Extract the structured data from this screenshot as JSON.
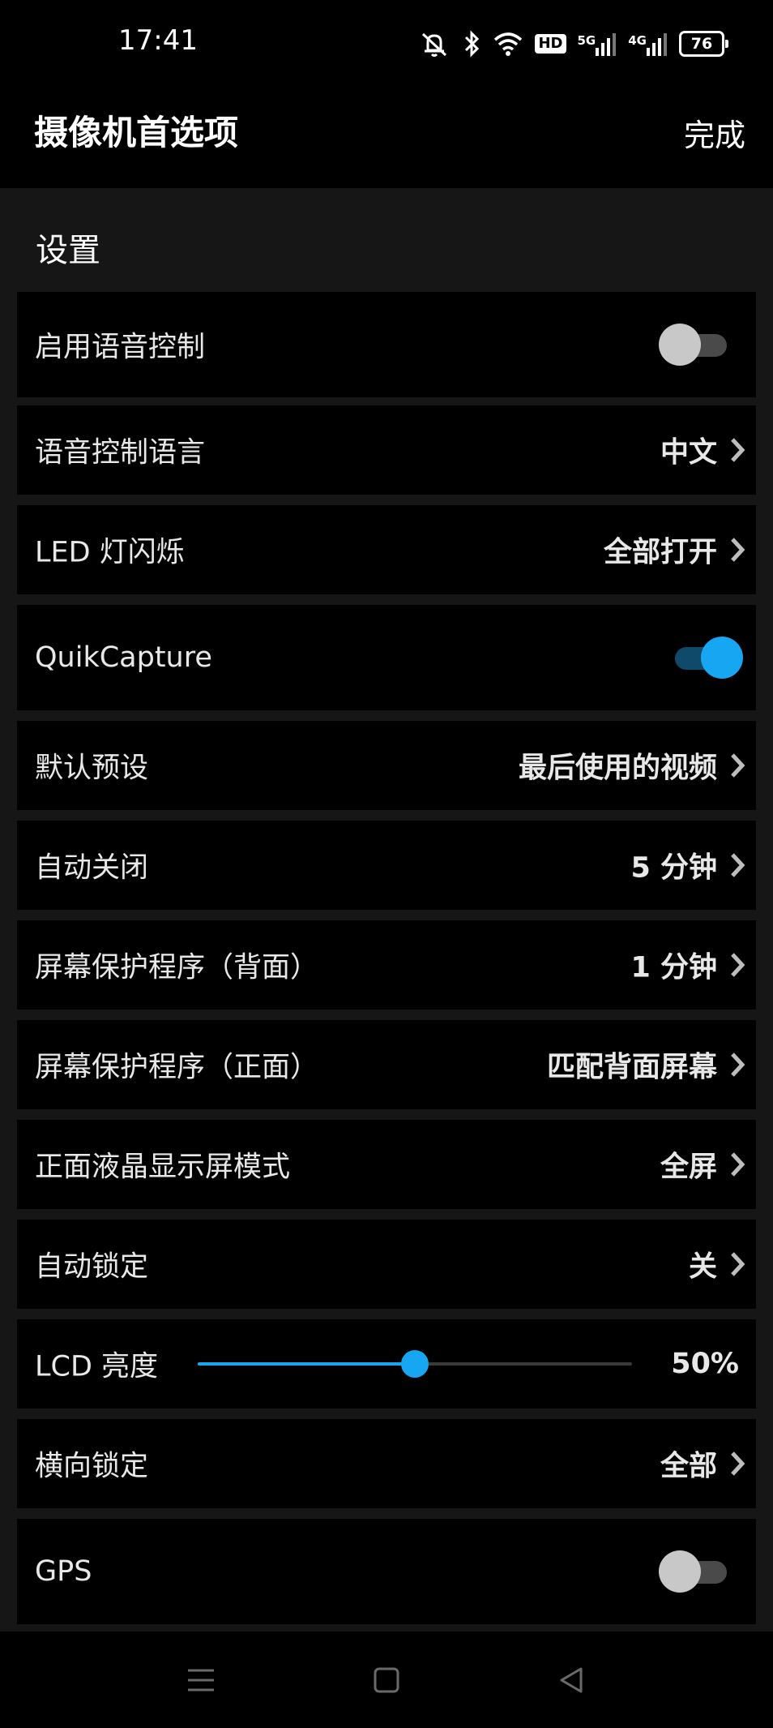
{
  "status_bar": {
    "time": "17:41",
    "hd_badge": "HD",
    "net_5g": "5G",
    "net_4g": "4G",
    "battery": "76"
  },
  "header": {
    "title": "摄像机首选项",
    "done_label": "完成"
  },
  "section": {
    "title": "设置"
  },
  "rows": [
    {
      "label": "启用语音控制",
      "type": "toggle",
      "state": "off"
    },
    {
      "label": "语音控制语言",
      "type": "nav",
      "value": "中文"
    },
    {
      "label": "LED 灯闪烁",
      "type": "nav",
      "value": "全部打开"
    },
    {
      "label": "QuikCapture",
      "type": "toggle",
      "state": "on"
    },
    {
      "label": "默认预设",
      "type": "nav",
      "value": "最后使用的视频"
    },
    {
      "label": "自动关闭",
      "type": "nav",
      "value": "5 分钟"
    },
    {
      "label": "屏幕保护程序（背面）",
      "type": "nav",
      "value": "1 分钟"
    },
    {
      "label": "屏幕保护程序（正面）",
      "type": "nav",
      "value": "匹配背面屏幕"
    },
    {
      "label": "正面液晶显示屏模式",
      "type": "nav",
      "value": "全屏"
    },
    {
      "label": "自动锁定",
      "type": "nav",
      "value": "关"
    },
    {
      "label": "LCD 亮度",
      "type": "slider",
      "value": "50%",
      "level": 0.5
    },
    {
      "label": "横向锁定",
      "type": "nav",
      "value": "全部"
    },
    {
      "label": "GPS",
      "type": "toggle",
      "state": "off"
    }
  ],
  "colors": {
    "accent": "#17a6f2",
    "row_bg": "#000000",
    "page_bg": "#161616"
  }
}
